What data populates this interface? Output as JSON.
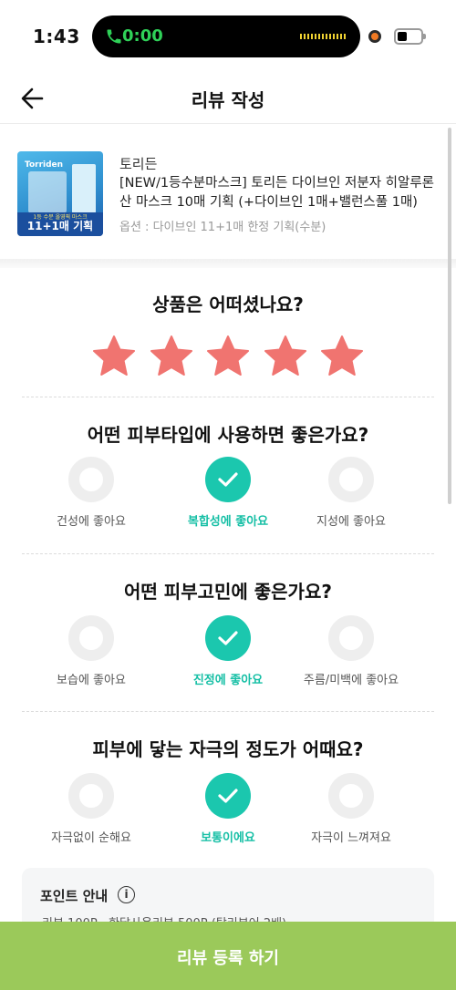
{
  "status_bar": {
    "time": "1:43",
    "call_time": "0:00"
  },
  "header": {
    "title": "리뷰 작성"
  },
  "product": {
    "brand": "토리든",
    "name": "[NEW/1등수분마스크] 토리든 다이브인 저분자 히알루론산 마스크 10매 기획 (+다이브인 1매+밸런스풀 1매)",
    "option": "옵션 : 다이브인 11+1매 한정 기획(수분)",
    "image_logo": "Torriden",
    "image_tagline": "1등 수분 올영픽 마스크",
    "image_badge": "11+1매 기획"
  },
  "rating": {
    "question": "상품은 어떠셨나요?",
    "stars": 5,
    "max_stars": 5,
    "star_color": "#f07470"
  },
  "skin_type": {
    "question": "어떤 피부타입에 사용하면 좋은가요?",
    "options": [
      "건성에 좋아요",
      "복합성에 좋아요",
      "지성에 좋아요"
    ],
    "selected": 1
  },
  "skin_concern": {
    "question": "어떤 피부고민에 좋은가요?",
    "options": [
      "보습에 좋아요",
      "진정에 좋아요",
      "주름/미백에 좋아요"
    ],
    "selected": 1
  },
  "irritation": {
    "question": "피부에 닿는 자극의 정도가 어때요?",
    "options": [
      "자극없이 순해요",
      "보통이에요",
      "자극이 느껴져요"
    ],
    "selected": 1
  },
  "point_info": {
    "title": "포인트 안내",
    "line1": "리뷰 100P · 한달사용리뷰 500P (탑리뷰어 2배)"
  },
  "submit": {
    "label": "리뷰 등록 하기"
  },
  "colors": {
    "accent": "#1bc7ae",
    "button": "#9bc95a",
    "star": "#f07470"
  }
}
